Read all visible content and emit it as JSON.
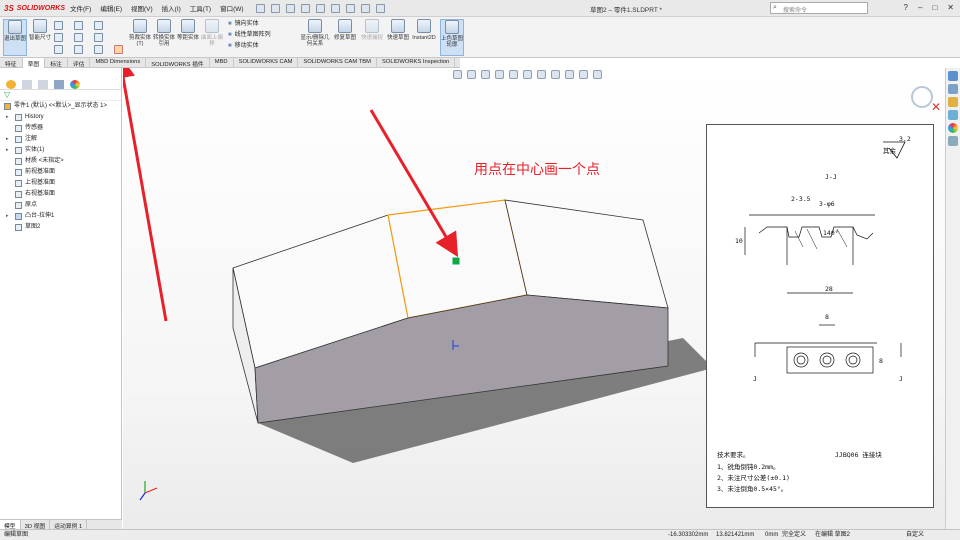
{
  "app": {
    "logo": "SOLIDWORKS",
    "document_title": "草图2 – 零件1.SLDPRT *"
  },
  "menu": [
    "文件(F)",
    "编辑(E)",
    "视图(V)",
    "插入(I)",
    "工具(T)",
    "窗口(W)"
  ],
  "search": {
    "placeholder": "搜索命令"
  },
  "ribbon": {
    "exit_sketch": "退出草图",
    "smart_dim": "智能尺寸",
    "trim": "剪裁实体(T)",
    "convert": "转换实体引用",
    "offset": "等距实体",
    "offset_surface": "曲面上偏移",
    "list": [
      "镜向实体",
      "线性草图阵列",
      "移动实体"
    ],
    "display_delete": "显示/删除几何关系",
    "repair": "修复草图",
    "quick_snaps": "快速捕捉",
    "rapid_sketch": "快速草图",
    "instant2d": "Instant2D",
    "shaded": "上色草图轮廓"
  },
  "tabs": [
    "特征",
    "草图",
    "标注",
    "评估",
    "MBD Dimensions",
    "SOLIDWORKS 插件",
    "MBD",
    "SOLIDWORKS CAM",
    "SOLIDWORKS CAM TBM",
    "SOLIDWORKS Inspection"
  ],
  "tree": {
    "root": "零件1 (默认) <<默认>_显示状态 1>",
    "items": [
      "History",
      "传感器",
      "注解",
      "实体(1)",
      "材质 <未指定>",
      "前视基准面",
      "上视基准面",
      "右视基准面",
      "原点",
      "凸台-拉伸1",
      "草图2"
    ]
  },
  "bottom_tabs": [
    "模型",
    "3D 视图",
    "运动算例 1"
  ],
  "annotation": "用点在中心画一个点",
  "drawing": {
    "roughness": "3.2",
    "roughness_prefix": "其余",
    "section": "J-J",
    "dim_chamfer": "2-3.5",
    "dim_hole": "3-φ6",
    "dim_angle": "140°",
    "dim_height": "10",
    "dim_width": "28",
    "dim_pitch": "8",
    "dim_depth": "8",
    "label_j": "J",
    "notes_title": "技术要求。",
    "notes": [
      "1、锐角倒钝0.2mm。",
      "2、未注尺寸公差(±0.1)",
      "3、未注倒角0.5×45°。"
    ],
    "part_name": "JJBQ06 连接块"
  },
  "status": {
    "left": "编辑草图",
    "x": "-16.303302mm",
    "y": "13.821421mm",
    "z": "0mm",
    "defined": "完全定义",
    "editing": "在编辑 草图2",
    "units": "自定义"
  },
  "colors": {
    "accent": "#e8202a",
    "selection": "#f39c12",
    "point": "#11aa33"
  }
}
